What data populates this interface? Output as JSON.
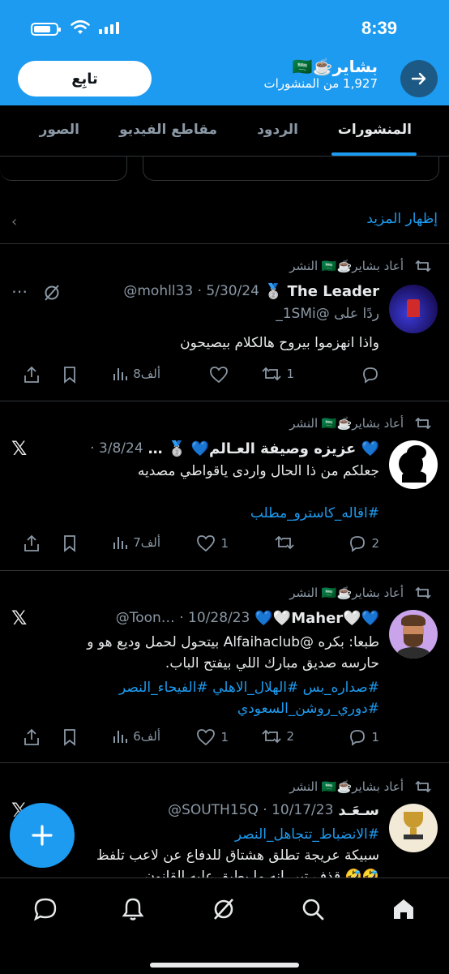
{
  "status_bar": {
    "time": "8:39"
  },
  "header": {
    "name": "بشاير☕️🇸🇦",
    "posts_count": "1,927 من المنشورات",
    "follow_label": "تابِع"
  },
  "tabs": [
    "المنشورات",
    "الردود",
    "مقاطع الفيديو",
    "الصور"
  ],
  "show_more": "إظهار المزيد",
  "posts": [
    {
      "reposted_by": "أعاد بشاير☕️🇸🇦 النشر",
      "name": "The Leader 🥈",
      "meta": "@mohll33 · 5/30/24",
      "reply_to": "ردًا على @1SMi_",
      "text": "واذا انهزموا  بيروح هالكلام بيصيحون",
      "replies": "",
      "reposts": "1",
      "likes": "",
      "views": "8ألف"
    },
    {
      "reposted_by": "أعاد بشاير☕️🇸🇦 النشر",
      "name": "💙 عزيزه وصيفة العـالم💙 🥈 …",
      "meta": "· 3/8/24",
      "text": "جعلكم من ذا الحال واردى ياقواطي مصديه",
      "hashtag": "#اقاله_كاسترو_مطلب",
      "replies": "2",
      "reposts": "",
      "likes": "1",
      "views": "7ألف"
    },
    {
      "reposted_by": "أعاد بشاير☕️🇸🇦 النشر",
      "name": "💙🤍Maher🤍💙",
      "meta": "@Toon… · 10/28/23",
      "text_line1": "طبعا: بكره @Alfaihaclub بيتحول لحمل وديع هو و",
      "text_line2": "حارسه صديق مبارك اللي بيفتح الباب.",
      "hashtags_line1": "#صداره_بس #الهلال_الاهلي #الفيحاء_النصر",
      "hashtags_line2": "#دوري_روشن_السعودي",
      "replies": "1",
      "reposts": "2",
      "likes": "1",
      "views": "6ألف"
    },
    {
      "reposted_by": "أعاد بشاير☕️🇸🇦 النشر",
      "name": "سـعَـد",
      "meta": "@SOUTH15Q · 10/17/23",
      "hashtag": "#الانضباط_تتجاهل_النصر",
      "text_line1": "سبيكة عريجة تطلق هشتاق للدفاع عن لاعب تلفظ",
      "text_line2": "🤣🤣 قذف تبي انه ما يطبق عليه القانون"
    }
  ],
  "colors": {
    "accent": "#1d9bf0",
    "background": "#000000",
    "muted": "#8b98a5"
  }
}
